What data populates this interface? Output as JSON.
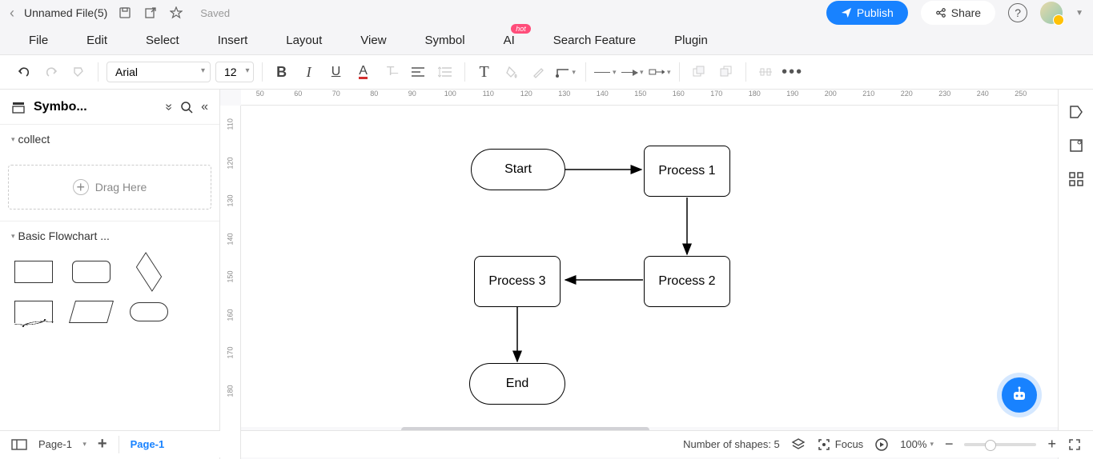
{
  "title_bar": {
    "file_name": "Unnamed File(5)",
    "saved_label": "Saved",
    "publish_label": "Publish",
    "share_label": "Share"
  },
  "menu": {
    "items": [
      "File",
      "Edit",
      "Select",
      "Insert",
      "Layout",
      "View",
      "Symbol",
      "AI",
      "Search Feature",
      "Plugin"
    ],
    "hot_badge": "hot"
  },
  "toolbar": {
    "font_family": "Arial",
    "font_size": "12"
  },
  "sidebar": {
    "title": "Symbo...",
    "section_collect": "collect",
    "drag_here": "Drag Here",
    "section_basic": "Basic Flowchart ..."
  },
  "ruler_h": [
    "50",
    "60",
    "70",
    "80",
    "90",
    "100",
    "110",
    "120",
    "130",
    "140",
    "150",
    "160",
    "170",
    "180",
    "190",
    "200",
    "210",
    "220",
    "230",
    "240",
    "250"
  ],
  "ruler_v": [
    "110",
    "120",
    "130",
    "140",
    "150",
    "160",
    "170",
    "180"
  ],
  "flowchart": {
    "start": "Start",
    "process1": "Process 1",
    "process2": "Process 2",
    "process3": "Process 3",
    "end": "End"
  },
  "bottom": {
    "page_name": "Page-1",
    "active_tab": "Page-1",
    "shapes_label": "Number of shapes: 5",
    "focus_label": "Focus",
    "zoom_label": "100%"
  }
}
